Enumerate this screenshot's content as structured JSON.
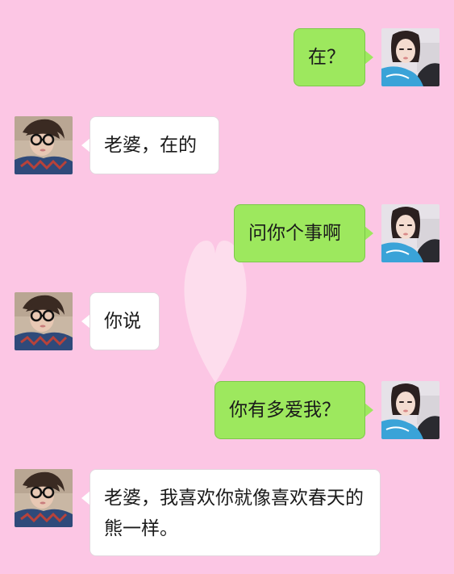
{
  "colors": {
    "background": "#fcc6e4",
    "sent_bubble": "#9de85e",
    "received_bubble": "#ffffff"
  },
  "messages": [
    {
      "sender": "girl",
      "text": "在？"
    },
    {
      "sender": "boy",
      "text": "老婆，在的"
    },
    {
      "sender": "girl",
      "text": "问你个事啊"
    },
    {
      "sender": "boy",
      "text": "你说"
    },
    {
      "sender": "girl",
      "text": "你有多爱我？"
    },
    {
      "sender": "boy",
      "text": "老婆，我喜欢你就像喜欢春天的熊一样。"
    }
  ],
  "avatars": {
    "girl": "girl-avatar",
    "boy": "boy-avatar"
  }
}
